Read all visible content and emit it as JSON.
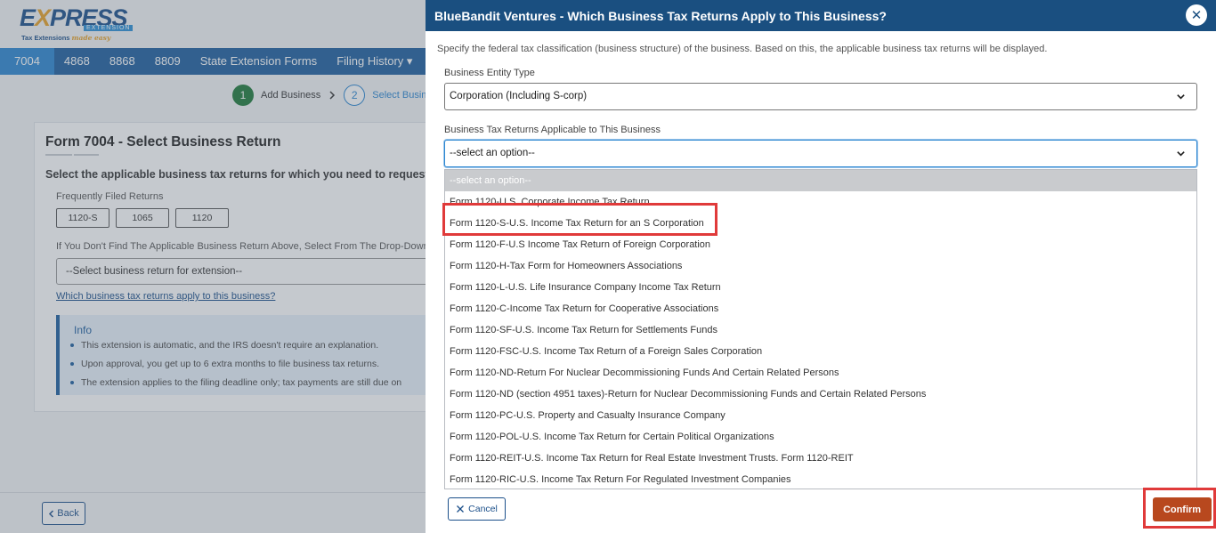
{
  "logo": {
    "brand_prefix": "E",
    "brand_x": "X",
    "brand_rest": "PRESS",
    "sub": "EXTENSION",
    "tagline_a": "Tax Extensions ",
    "tagline_b": "made easy"
  },
  "nav": [
    "7004",
    "4868",
    "8868",
    "8809",
    "State Extension Forms",
    "Filing History ▾"
  ],
  "stepper": {
    "step1_num": "1",
    "step1_label": "Add Business",
    "step2_num": "2",
    "step2_label": "Select Busines"
  },
  "card": {
    "title": "Form 7004 - Select Business Return",
    "question": "Select the applicable business tax returns for which you need to request an e",
    "frequent_label": "Frequently Filed Returns",
    "pills": [
      "1120-S",
      "1065",
      "1120"
    ],
    "dropdown_note": "If You Don't Find The Applicable Business Return Above, Select From The Drop-Down",
    "select_placeholder": "--Select business return for extension--",
    "link": "Which business tax returns apply to this business?",
    "info_title": "Info",
    "info_items": [
      "This extension is automatic, and the IRS doesn't require an explanation.",
      "Upon approval, you get up to 6 extra months to file business tax returns.",
      "The extension applies to the filing deadline only; tax payments are still due on"
    ]
  },
  "back_label": "Back",
  "modal": {
    "title": "BlueBandit Ventures - Which Business Tax Returns Apply to This Business?",
    "close": "✕",
    "description": "Specify the federal tax classification (business structure) of the business. Based on this, the applicable business tax returns will be displayed.",
    "entity_label": "Business Entity Type",
    "entity_value": "Corporation (Including S-corp)",
    "returns_label": "Business Tax Returns Applicable to This Business",
    "returns_value": "--select an option--",
    "options": [
      "--select an option--",
      "Form 1120-U.S. Corporate Income Tax Return",
      "Form 1120-S-U.S. Income Tax Return for an S Corporation",
      "Form 1120-F-U.S Income Tax Return of Foreign Corporation",
      "Form 1120-H-Tax Form for Homeowners Associations",
      "Form 1120-L-U.S. Life Insurance Company Income Tax Return",
      "Form 1120-C-Income Tax Return for Cooperative Associations",
      "Form 1120-SF-U.S. Income Tax Return for Settlements Funds",
      "Form 1120-FSC-U.S. Income Tax Return of a Foreign Sales Corporation",
      "Form 1120-ND-Return For Nuclear Decommissioning Funds And Certain Related Persons",
      "Form 1120-ND (section 4951 taxes)-Return for Nuclear Decommissioning Funds and Certain Related Persons",
      "Form 1120-PC-U.S. Property and Casualty Insurance Company",
      "Form 1120-POL-U.S. Income Tax Return for Certain Political Organizations",
      "Form 1120-REIT-U.S. Income Tax Return for Real Estate Investment Trusts. Form 1120-REIT",
      "Form 1120-RIC-U.S. Income Tax Return For Regulated Investment Companies"
    ],
    "cancel_label": "Cancel",
    "confirm_label": "Confirm"
  },
  "colors": {
    "header": "#1a4f80",
    "nav": "#1e5f9e",
    "confirm": "#b8481e",
    "highlight": "#e03a3a"
  }
}
